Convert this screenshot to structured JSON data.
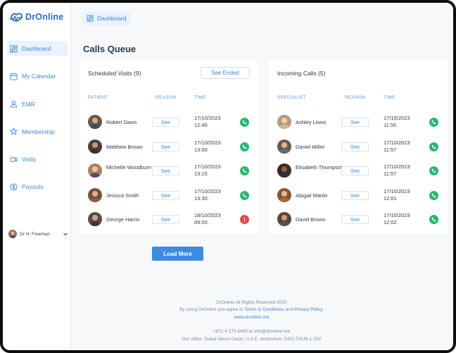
{
  "app": {
    "name": "DrOnline",
    "brand_color": "#2d6db5",
    "accent_color": "#3b87d1",
    "success_color": "#2bb673",
    "danger_color": "#e5484d"
  },
  "sidebar": {
    "items": [
      {
        "label": "Dashboard",
        "icon": "dashboard-icon",
        "active": true
      },
      {
        "label": "My Calendar",
        "icon": "calendar-icon",
        "active": false
      },
      {
        "label": "EMR",
        "icon": "user-icon",
        "active": false
      },
      {
        "label": "Membership",
        "icon": "star-icon",
        "active": false
      },
      {
        "label": "Visits",
        "icon": "video-icon",
        "active": false
      },
      {
        "label": "Payouts",
        "icon": "dollar-icon",
        "active": false
      }
    ],
    "user": {
      "name": "Dr H. Freeman"
    }
  },
  "topbar": {
    "breadcrumb": "Dashboard"
  },
  "page": {
    "title": "Calls Queue"
  },
  "scheduled": {
    "title": "Scheduled Visits (9)",
    "see_ended_label": "See Ended",
    "columns": {
      "patient": "PATIENT",
      "reason": "REASON",
      "time": "TIME"
    },
    "rows": [
      {
        "name": "Robert Davis",
        "reason": "See",
        "date": "17/10/2023",
        "time": "12:45",
        "status": "call"
      },
      {
        "name": "Matthew Brown",
        "reason": "See",
        "date": "17/10/2023",
        "time": "13:00",
        "status": "call"
      },
      {
        "name": "Michelle Woodburn",
        "reason": "See",
        "date": "17/10/2023",
        "time": "13:15",
        "status": "call"
      },
      {
        "name": "Jessica Smith",
        "reason": "See",
        "date": "17/10/2023",
        "time": "13:30",
        "status": "call"
      },
      {
        "name": "George Harris",
        "reason": "See",
        "date": "18/10/2023",
        "time": "09:00",
        "status": "alert"
      }
    ]
  },
  "incoming": {
    "title": "Incoming Calls (5)",
    "columns": {
      "specialist": "SPECIALIST",
      "reason": "REASON",
      "time": "TIME"
    },
    "rows": [
      {
        "name": "Ashley Lewis",
        "reason": "See",
        "date": "17/10/2023",
        "time": "11:55",
        "status": "call"
      },
      {
        "name": "Daniel Miller",
        "reason": "See",
        "date": "17/10/2023",
        "time": "11:57",
        "status": "call"
      },
      {
        "name": "Elisabeth Thompson",
        "reason": "See",
        "date": "17/10/2023",
        "time": "11:57",
        "status": "call"
      },
      {
        "name": "Abigail Martin",
        "reason": "See",
        "date": "17/10/2023",
        "time": "12:01",
        "status": "call"
      },
      {
        "name": "David Brown",
        "reason": "See",
        "date": "17/10/2023",
        "time": "12:02",
        "status": "call"
      }
    ]
  },
  "load_more_label": "Load More",
  "footer": {
    "copyright": "DrOnline All Rights Reserved 2020",
    "agree_prefix": "By using DrOnline you agree to",
    "terms": "Terms & Conditions",
    "and": "and",
    "privacy": "Privacy Policy.",
    "website": "www.dronline.me",
    "contact": "+971 4 275 6483 or info@dronline.me",
    "office": "Our office: Dubai silicon Oasis, U.A.E, technohub, DSO-THUB-1-152"
  }
}
